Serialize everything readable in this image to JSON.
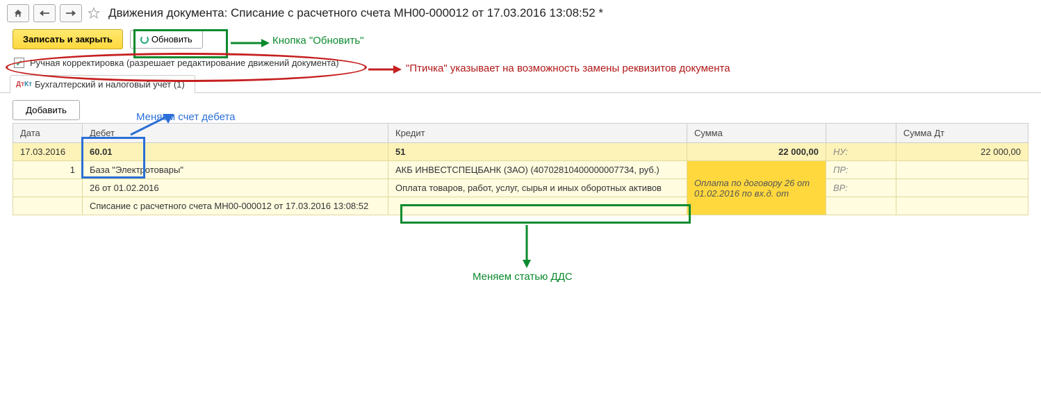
{
  "header": {
    "title": "Движения документа: Списание с расчетного счета МН00-000012 от 17.03.2016 13:08:52 *"
  },
  "toolbar": {
    "save_close": "Записать и закрыть",
    "refresh": "Обновить"
  },
  "checkbox": {
    "label": "Ручная корректировка (разрешает редактирование движений документа)"
  },
  "tab": {
    "label": "Бухгалтерский и налоговый учет (1)"
  },
  "buttons": {
    "add": "Добавить"
  },
  "grid": {
    "headers": {
      "date": "Дата",
      "debit": "Дебет",
      "credit": "Кредит",
      "sum": "Сумма",
      "sum_dt": "Сумма Дт"
    },
    "row1": {
      "date": "17.03.2016",
      "debit": "60.01",
      "credit": "51",
      "sum": "22 000,00",
      "nu": "НУ:",
      "sum_dt": "22 000,00"
    },
    "row2": {
      "num": "1",
      "debit": "База \"Электротовары\"",
      "credit": "АКБ ИНВЕСТСПЕЦБАНК (ЗАО) (40702810400000007734, руб.)",
      "payment": "Оплата по договору 26 от 01.02.2016 по вх.д.  от",
      "pr": "ПР:"
    },
    "row3": {
      "debit": "26 от 01.02.2016",
      "credit": "Оплата товаров, работ, услуг, сырья и иных оборотных активов",
      "vr": "ВР:"
    },
    "row4": {
      "debit": "Списание с расчетного счета МН00-000012 от 17.03.2016 13:08:52"
    }
  },
  "annotations": {
    "refresh_btn": "Кнопка \"Обновить\"",
    "checkbox_note": "\"Птичка\" указывает на возможность замены реквизитов документа",
    "debit_note": "Меняем счет дебета",
    "dds_note": "Меняем статью ДДС"
  }
}
